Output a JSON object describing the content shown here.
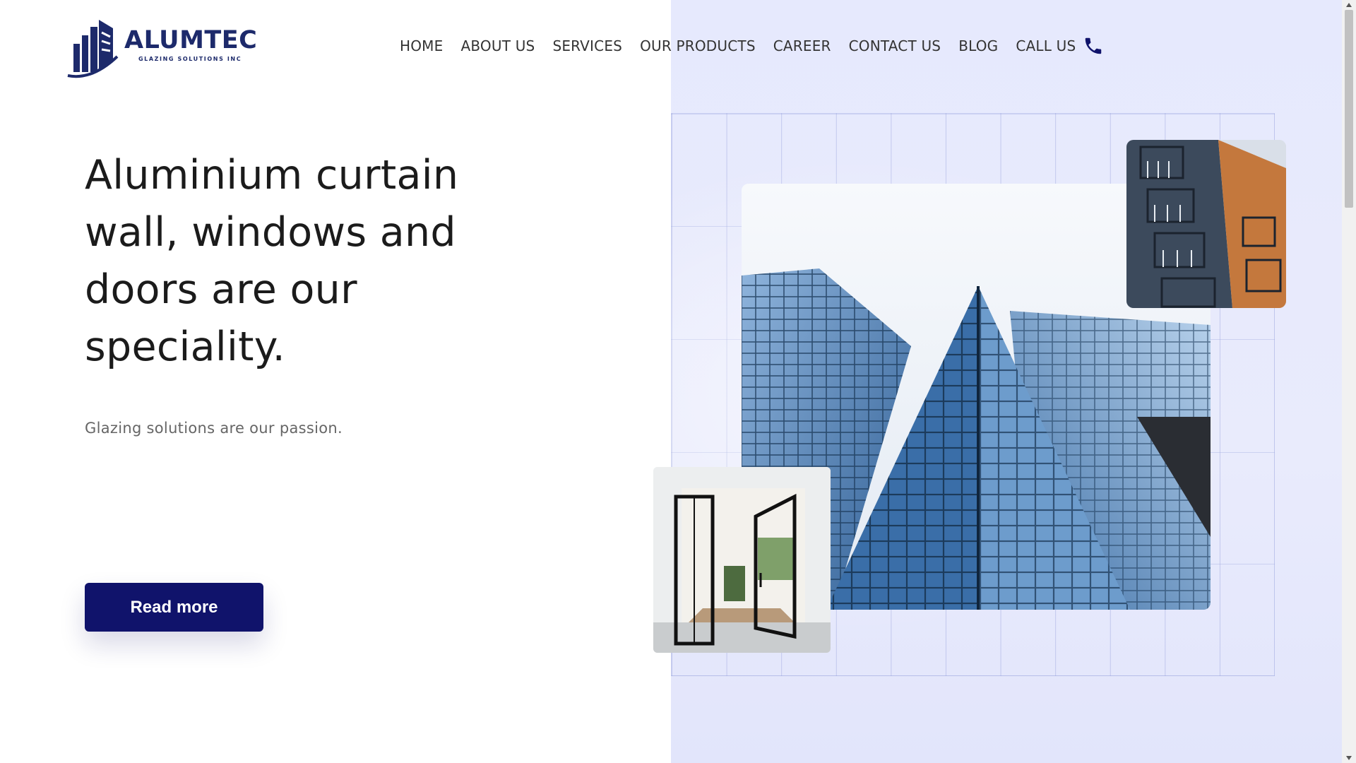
{
  "brand": {
    "name": "ALUMTEC",
    "tagline": "GLAZING SOLUTIONS INC",
    "color": "#1d2a6b"
  },
  "nav": {
    "items": [
      {
        "label": "HOME"
      },
      {
        "label": "ABOUT US"
      },
      {
        "label": "SERVICES"
      },
      {
        "label": "OUR PRODUCTS"
      },
      {
        "label": "CAREER"
      },
      {
        "label": "CONTACT US"
      },
      {
        "label": "BLOG"
      }
    ],
    "call_label": "CALL US",
    "call_icon": "phone-icon"
  },
  "hero": {
    "title": "Aluminium curtain wall, windows and doors are our speciality.",
    "subtitle": "Glazing solutions are our passion.",
    "cta_label": "Read more",
    "cta_color": "#10136b"
  },
  "images": {
    "main": "glass-skyscraper-photo",
    "top": "balcony-building-photo",
    "bottom": "glass-door-interior-photo"
  },
  "colors": {
    "panel": "#e6e9fd",
    "accent": "#10136b"
  }
}
